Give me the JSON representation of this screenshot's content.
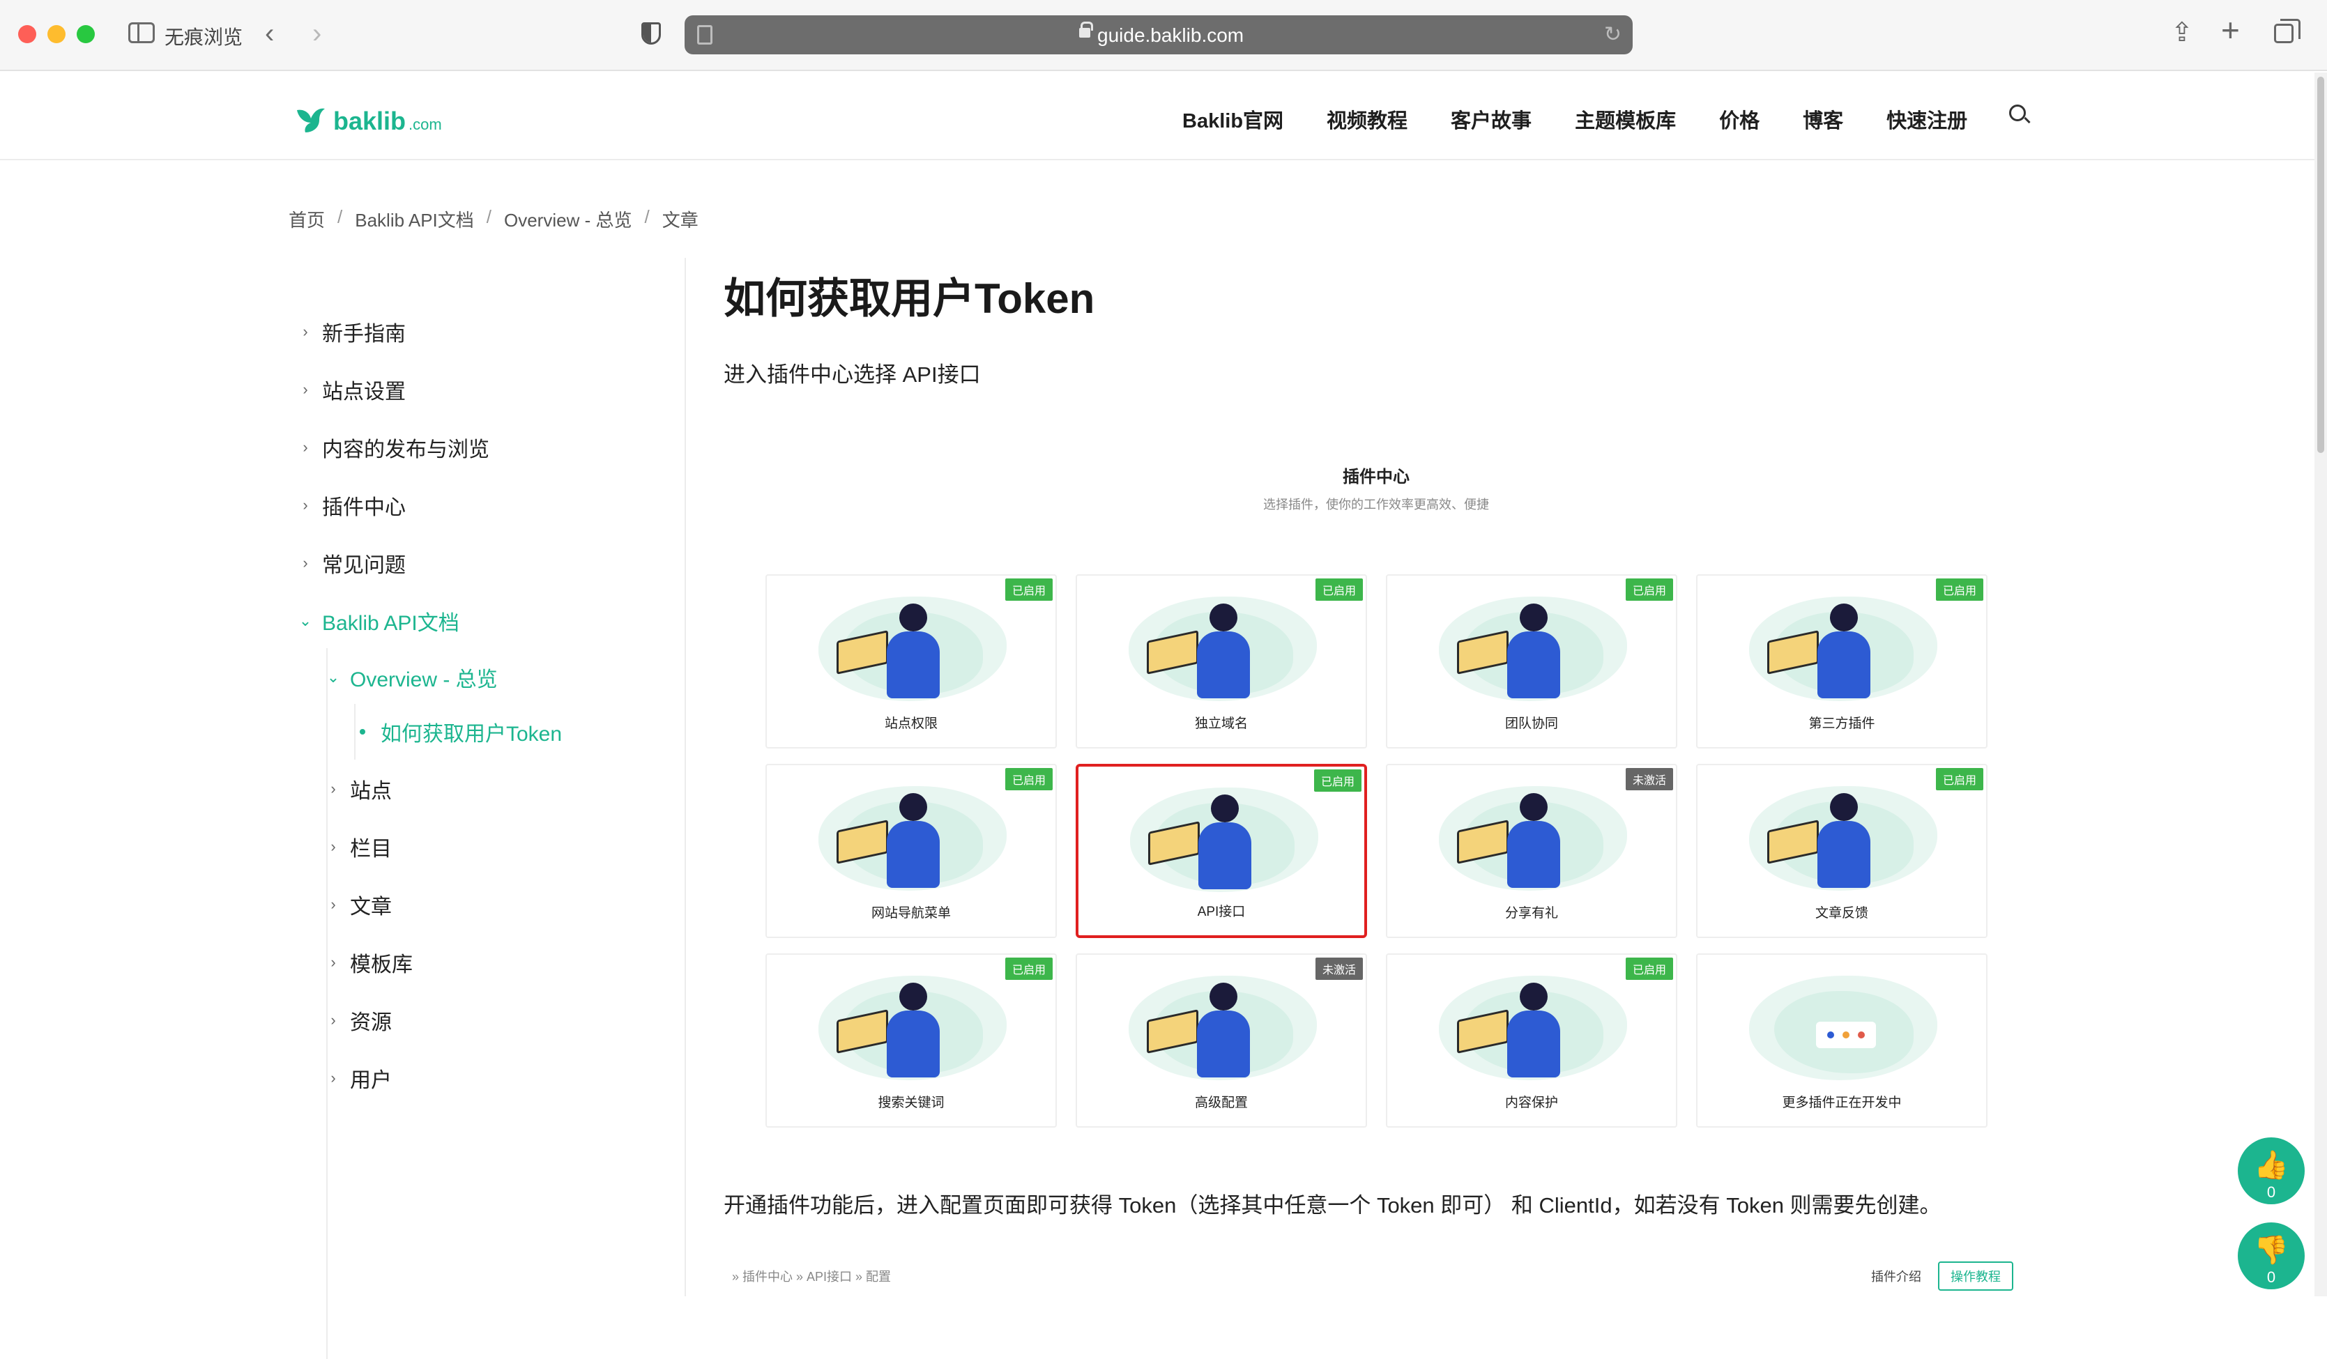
{
  "browser": {
    "private_label": "无痕浏览",
    "url": "guide.baklib.com"
  },
  "site": {
    "logo_text": "baklib",
    "logo_suffix": ".com",
    "nav": [
      "Baklib官网",
      "视频教程",
      "客户故事",
      "主题模板库",
      "价格",
      "博客",
      "快速注册"
    ]
  },
  "breadcrumb": [
    "首页",
    "Baklib API文档",
    "Overview - 总览",
    "文章"
  ],
  "sidebar": {
    "items": [
      {
        "label": "新手指南",
        "expanded": false
      },
      {
        "label": "站点设置",
        "expanded": false
      },
      {
        "label": "内容的发布与浏览",
        "expanded": false
      },
      {
        "label": "插件中心",
        "expanded": false
      },
      {
        "label": "常见问题",
        "expanded": false
      },
      {
        "label": "Baklib API文档",
        "expanded": true
      }
    ],
    "sub_items": [
      {
        "label": "Overview - 总览",
        "expanded": true
      },
      {
        "label": "站点"
      },
      {
        "label": "栏目"
      },
      {
        "label": "文章"
      },
      {
        "label": "模板库"
      },
      {
        "label": "资源"
      },
      {
        "label": "用户"
      }
    ],
    "current": "如何获取用户Token"
  },
  "article": {
    "title": "如何获取用户Token",
    "p1": "进入插件中心选择 API接口",
    "p2": "开通插件功能后，进入配置页面即可获得 Token（选择其中任意一个 Token 即可） 和 ClientId，如若没有 Token 则需要先创建。"
  },
  "plugin_figure": {
    "title": "插件中心",
    "subtitle": "选择插件，使你的工作效率更高效、便捷",
    "cards": [
      {
        "name": "站点权限",
        "badge": "已启用",
        "active": true
      },
      {
        "name": "独立域名",
        "badge": "已启用",
        "active": true
      },
      {
        "name": "团队协同",
        "badge": "已启用",
        "active": true
      },
      {
        "name": "第三方插件",
        "badge": "已启用",
        "active": true
      },
      {
        "name": "网站导航菜单",
        "badge": "已启用",
        "active": true
      },
      {
        "name": "API接口",
        "badge": "已启用",
        "active": true,
        "highlighted": true
      },
      {
        "name": "分享有礼",
        "badge": "未激活",
        "active": false
      },
      {
        "name": "文章反馈",
        "badge": "已启用",
        "active": true
      },
      {
        "name": "搜索关键词",
        "badge": "已启用",
        "active": true
      },
      {
        "name": "高级配置",
        "badge": "未激活",
        "active": false
      },
      {
        "name": "内容保护",
        "badge": "已启用",
        "active": true
      },
      {
        "name": "更多插件正在开发中",
        "badge": "",
        "active": false
      }
    ]
  },
  "bottom_strip": {
    "path": "» 插件中心 » API接口 » 配置",
    "intro_label": "插件介绍",
    "tutorial_button": "操作教程"
  },
  "votes": {
    "up_count": "0",
    "down_count": "0"
  },
  "colors": {
    "accent": "#1cb58f",
    "badge_active": "#3db64b",
    "badge_inactive": "#666666",
    "highlight": "#e02020"
  }
}
